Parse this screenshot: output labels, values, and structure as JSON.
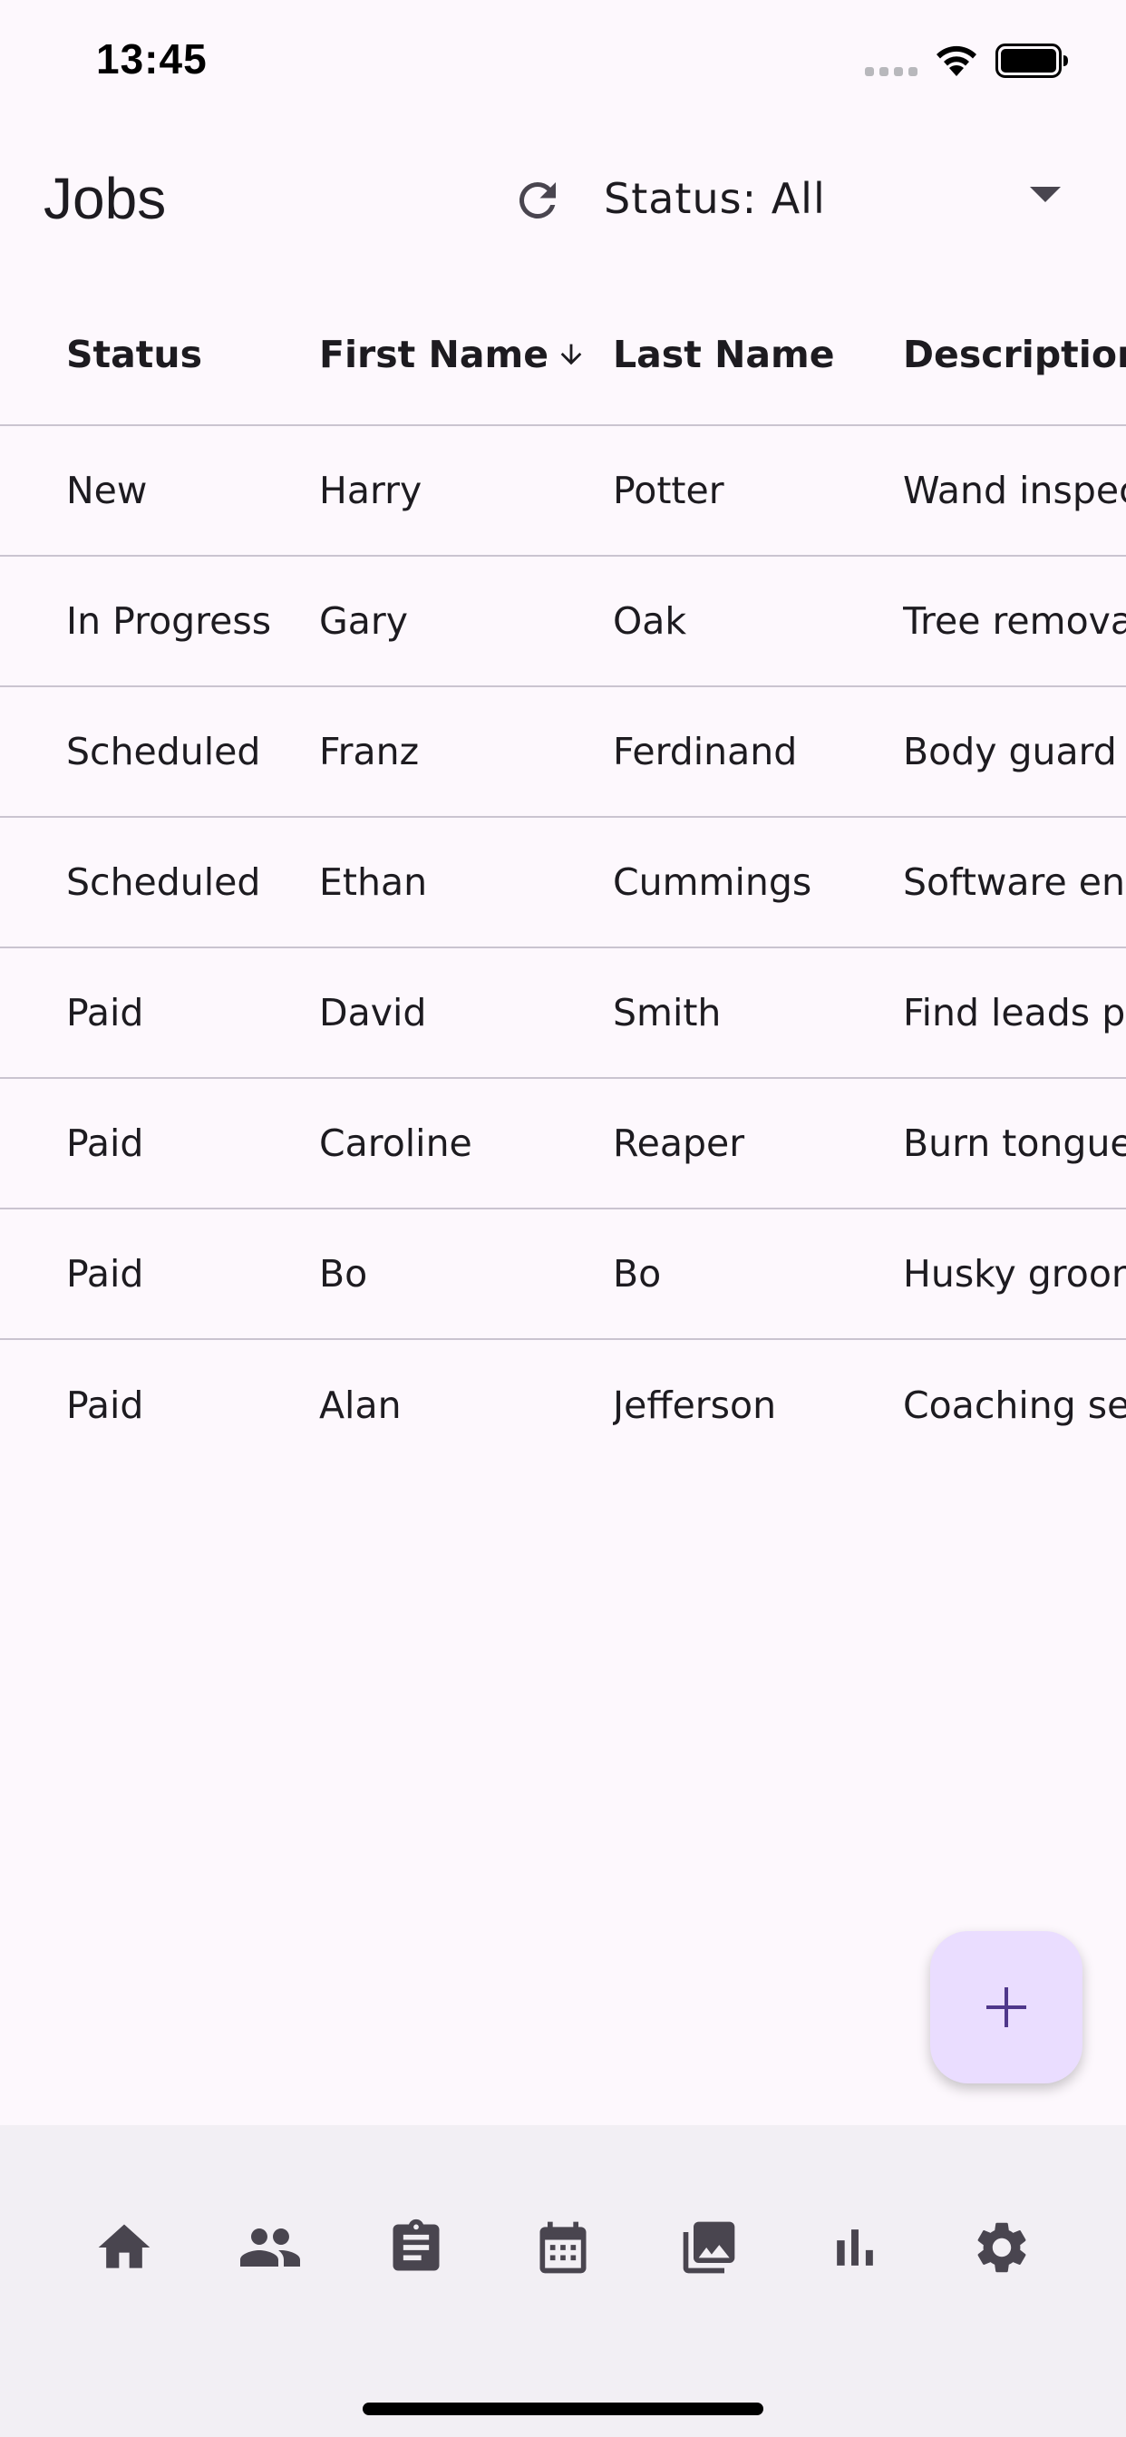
{
  "status_bar": {
    "time": "13:45"
  },
  "app_bar": {
    "title": "Jobs",
    "refresh_icon": "refresh-icon",
    "filter_label": "Status: All"
  },
  "table": {
    "columns": [
      "Status",
      "First Name",
      "Last Name",
      "Description"
    ],
    "sort": {
      "column": "First Name",
      "direction": "descending"
    },
    "rows": [
      [
        "New",
        "Harry",
        "Potter",
        "Wand inspec"
      ],
      [
        "In Progress",
        "Gary",
        "Oak",
        "Tree remova"
      ],
      [
        "Scheduled",
        "Franz",
        "Ferdinand",
        "Body guard"
      ],
      [
        "Scheduled",
        "Ethan",
        "Cummings",
        "Software en"
      ],
      [
        "Paid",
        "David",
        "Smith",
        "Find leads p"
      ],
      [
        "Paid",
        "Caroline",
        "Reaper",
        "Burn tongue"
      ],
      [
        "Paid",
        "Bo",
        "Bo",
        "Husky groon"
      ],
      [
        "Paid",
        "Alan",
        "Jefferson",
        "Coaching se"
      ]
    ]
  },
  "fab": {
    "icon": "add-icon",
    "color": "#EADDFF"
  },
  "bottom_nav": {
    "items": [
      "home-icon",
      "people-icon",
      "clipboard-icon",
      "calendar-icon",
      "photos-icon",
      "chart-icon",
      "settings-icon"
    ]
  },
  "colors": {
    "background": "#FDF8FD",
    "nav_background": "#F2EFF4",
    "divider": "#CAC4D0",
    "icon": "#49454F",
    "fab_icon": "#4F378B"
  }
}
